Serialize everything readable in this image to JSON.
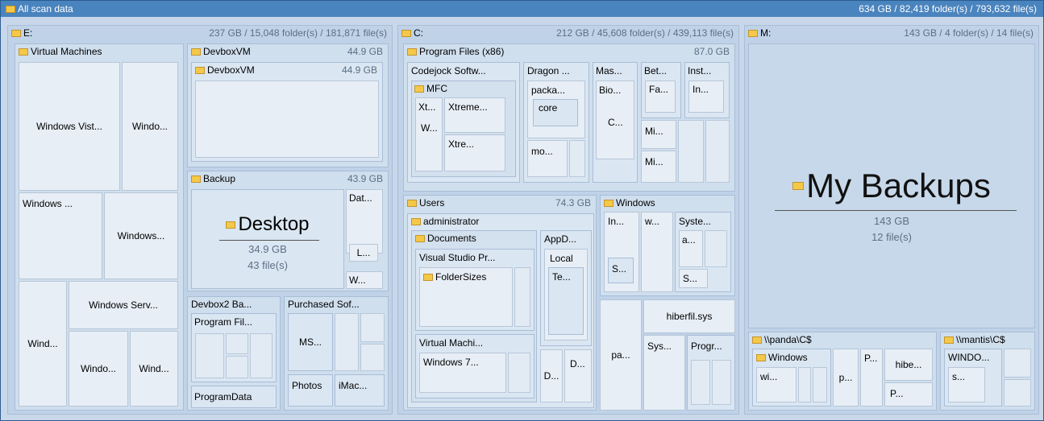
{
  "title_bar": {
    "label": "All scan data",
    "summary": "634 GB / 82,419 folder(s) / 793,632 file(s)"
  },
  "drives": {
    "e": {
      "label": "E:",
      "summary": "237 GB / 15,048 folder(s) / 181,871 file(s)"
    },
    "c": {
      "label": "C:",
      "summary": "212 GB / 45,608 folder(s) / 439,113 file(s)"
    },
    "m": {
      "label": "M:",
      "summary": "143 GB / 4 folder(s) / 14 file(s)"
    }
  },
  "e_drive": {
    "virtual_machines": {
      "label": "Virtual Machines"
    },
    "vm_items": [
      "Windows Vist...",
      "Windo...",
      "Windows ...",
      "Windows...",
      "Windows Serv...",
      "Wind...",
      "Windo...",
      "Wind..."
    ],
    "devboxvm": {
      "label": "DevboxVM",
      "size": "44.9 GB",
      "child_label": "DevboxVM",
      "child_size": "44.9 GB"
    },
    "backup": {
      "label": "Backup",
      "size": "43.9 GB",
      "desktop_label": "Desktop",
      "desktop_size": "34.9 GB",
      "desktop_files": "43 file(s)",
      "side_items": [
        "Dat...",
        "L...",
        "W..."
      ]
    },
    "devbox2": {
      "label": "Devbox2 Ba...",
      "items": [
        "Program Fil...",
        "ProgramData"
      ]
    },
    "purchased": {
      "label": "Purchased Sof...",
      "items": [
        "MS...",
        "Photos",
        "iMac..."
      ]
    }
  },
  "c_drive": {
    "program_files": {
      "label": "Program Files (x86)",
      "size": "87.0 GB",
      "items": [
        "Codejock Softw...",
        "MFC",
        "Xt...",
        "Xtreme...",
        "W...",
        "Xtre...",
        "Dragon ...",
        "packa...",
        "core",
        "mo...",
        "Mas...",
        "Bio...",
        "C...",
        "Bet...",
        "Fa...",
        "Inst...",
        "In...",
        "Mi...",
        "Mi..."
      ]
    },
    "users": {
      "label": "Users",
      "size": "74.3 GB",
      "admin": "administrator",
      "documents": "Documents",
      "vs": "Visual Studio Pr...",
      "folder_sizes": "FolderSizes",
      "virtual_machi": "Virtual Machi...",
      "windows7": "Windows 7...",
      "appd": "AppD...",
      "local": "Local",
      "te": "Te...",
      "d1": "D...",
      "d2": "D..."
    },
    "windows": {
      "label": "Windows",
      "items": [
        "In...",
        "w...",
        "Syste...",
        "a...",
        "S...",
        "S..."
      ]
    },
    "misc": {
      "pa": "pa...",
      "hiberfil": "hiberfil.sys",
      "sys": "Sys...",
      "progr": "Progr..."
    }
  },
  "m_drive": {
    "my_backups": {
      "label": "My Backups",
      "size": "143 GB",
      "files": "12 file(s)"
    },
    "panda": {
      "label": "\\\\panda\\C$",
      "windows": "Windows",
      "wi": "wi...",
      "p1": "p...",
      "p2": "P...",
      "hibe": "hibe...",
      "p3": "P..."
    },
    "mantis": {
      "label": "\\\\mantis\\C$",
      "windo": "WINDO...",
      "s": "s..."
    }
  }
}
